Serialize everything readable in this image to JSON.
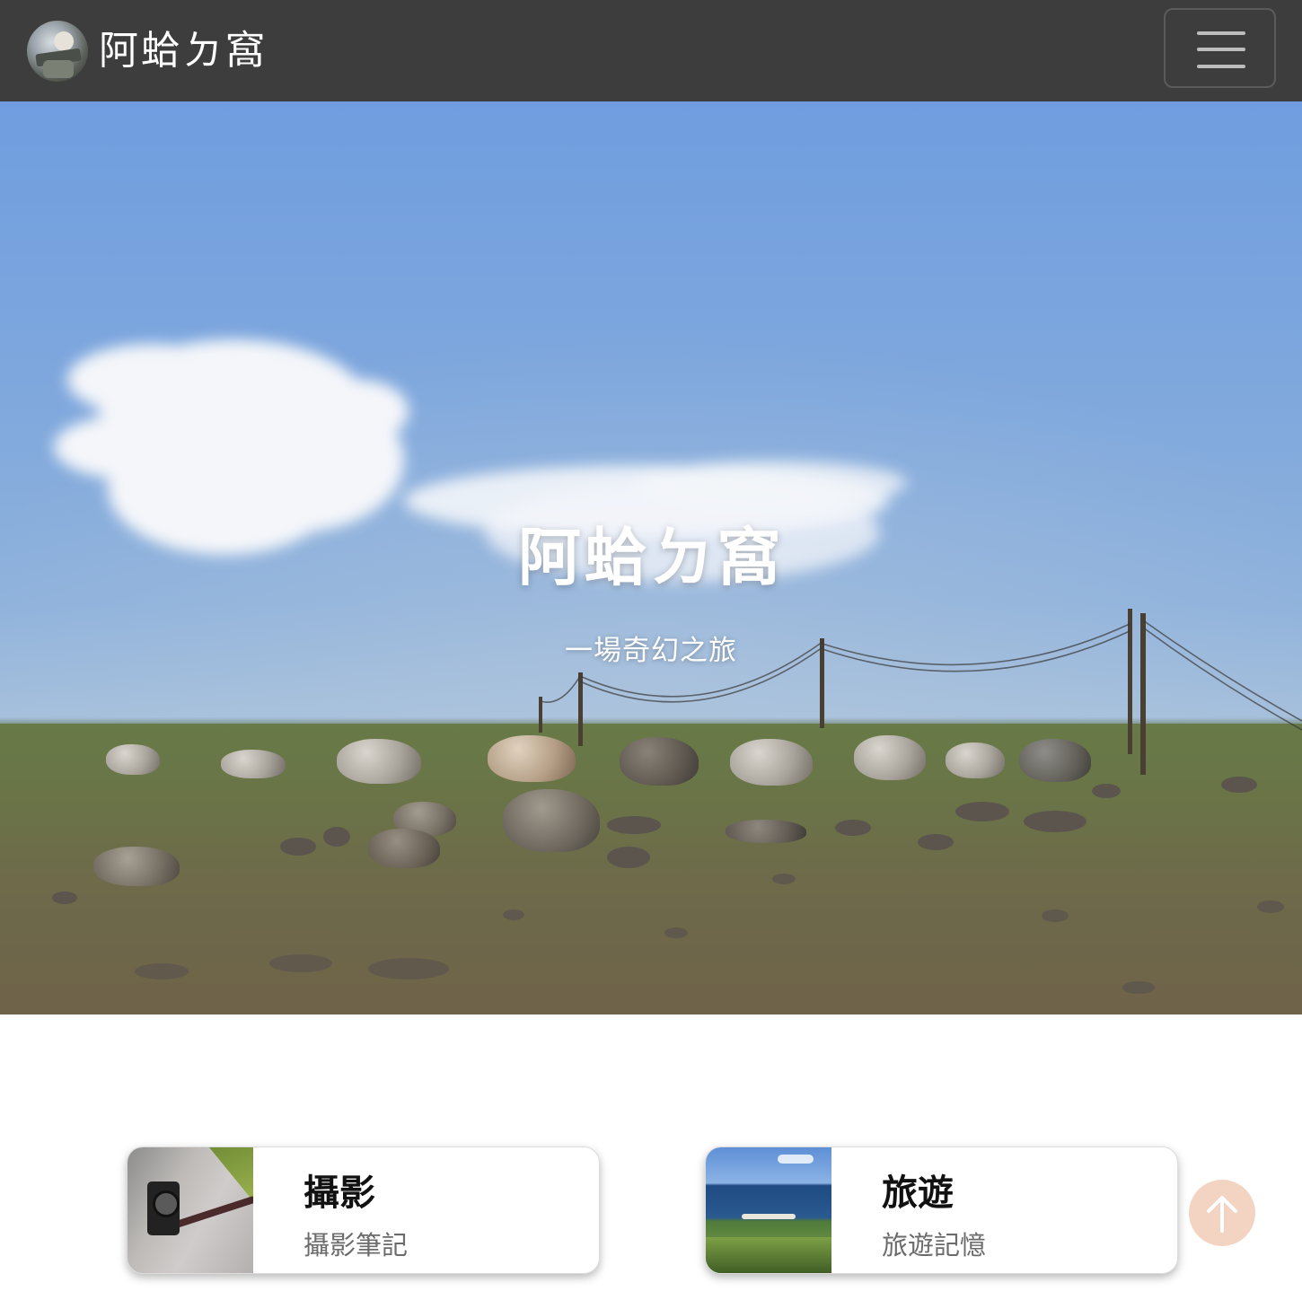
{
  "navbar": {
    "brand_title": "阿蛤ㄉ窩",
    "avatar_icon": "profile-photo-icon",
    "menu_icon": "hamburger-menu-icon",
    "background": "#3d3d3d"
  },
  "hero": {
    "title": "阿蛤ㄉ窩",
    "subtitle": "一場奇幻之旅"
  },
  "cards": [
    {
      "title": "攝影",
      "subtitle": "攝影筆記",
      "thumb_icon": "camera-photo-thumbnail"
    },
    {
      "title": "旅遊",
      "subtitle": "旅遊記憶",
      "thumb_icon": "coastline-photo-thumbnail"
    }
  ],
  "back_to_top": {
    "icon": "arrow-up-icon",
    "color": "#eec4ac"
  }
}
